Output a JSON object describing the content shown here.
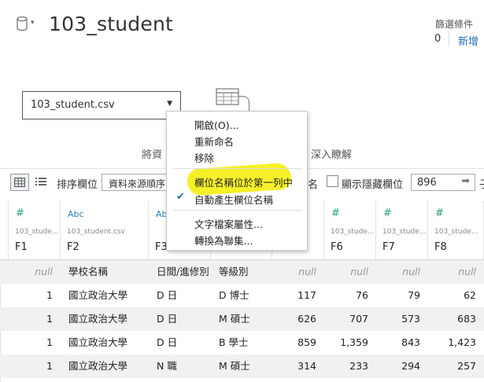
{
  "header": {
    "title": "103_student",
    "filter_label": "篩選條件",
    "filter_count": "0",
    "filter_add": "新增"
  },
  "source": {
    "selected": "103_student.csv"
  },
  "hints": {
    "left": "將資",
    "right": "深入瞭解"
  },
  "toolbar": {
    "sort_label": "排序欄位",
    "sort_value": "資料來源順序",
    "name_fragment": "名",
    "show_hidden_label": "顯示隱藏欄位",
    "rows_value": "896",
    "edge_fragment": "子"
  },
  "menu": {
    "items": [
      "開啟(O)...",
      "重新命名",
      "移除",
      "欄位名稱位於第一列中",
      "自動產生欄位名稱",
      "文字檔案屬性...",
      "轉換為聯集..."
    ],
    "checked_item": "自動產生欄位名稱",
    "highlighted_item": "欄位名稱位於第一列中"
  },
  "columns": [
    {
      "type": "#",
      "source": "",
      "name": ""
    },
    {
      "type": "#",
      "source": "103_stude...",
      "name": "F1"
    },
    {
      "type": "Abc",
      "source": "103_student.csv",
      "name": "F2"
    },
    {
      "type": "Abc",
      "source": "",
      "name": "F3"
    },
    {
      "type": "Abc",
      "source": "",
      "name": ""
    },
    {
      "type": "#",
      "source": "",
      "name": ""
    },
    {
      "type": "#",
      "source": "103_stude...",
      "name": "F6"
    },
    {
      "type": "#",
      "source": "103_stude...",
      "name": "F7"
    },
    {
      "type": "#",
      "source": "103_stude...",
      "name": "F8"
    }
  ],
  "rows": [
    [
      "null",
      "學校名稱",
      "日間/進修別",
      "等級別",
      "null",
      "null",
      "null",
      "null"
    ],
    [
      "1",
      "國立政治大學",
      "D 日",
      "D 博士",
      "117",
      "76",
      "79",
      "62"
    ],
    [
      "1",
      "國立政治大學",
      "D 日",
      "M 碩士",
      "626",
      "707",
      "573",
      "683"
    ],
    [
      "1",
      "國立政治大學",
      "D 日",
      "B 學士",
      "859",
      "1,359",
      "843",
      "1,423"
    ],
    [
      "1",
      "國立政治大學",
      "N 職",
      "M 碩士",
      "314",
      "233",
      "294",
      "257"
    ]
  ]
}
